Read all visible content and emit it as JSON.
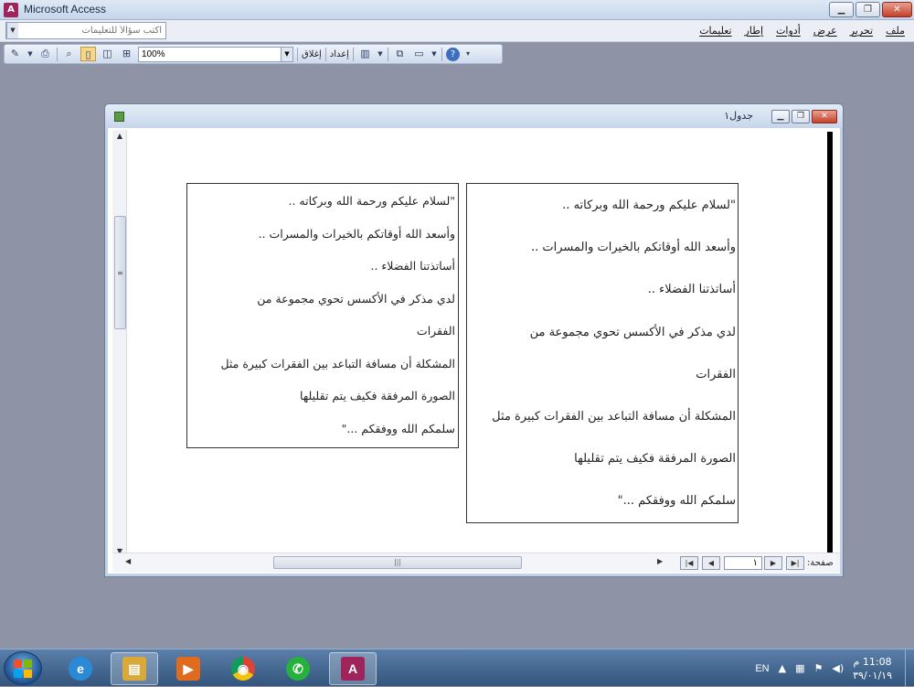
{
  "app": {
    "title": "Microsoft Access",
    "icon_letter": "A"
  },
  "window_controls": {
    "minimize": "▁",
    "restore": "❐",
    "close": "✕"
  },
  "help_box": {
    "placeholder": "اكتب سؤالاً للتعليمات"
  },
  "menus": [
    "ملف",
    "تحرير",
    "عرض",
    "أدوات",
    "إطار",
    "تعليمات"
  ],
  "toolbar": {
    "zoom_value": "100%",
    "close_label": "إغلاق",
    "setup_label": "إعداد"
  },
  "document": {
    "title": "جدول١",
    "paragraph_lines": [
      "\"لسلام عليكم ورحمة الله وبركاته ..",
      "وأسعد الله أوقاتكم بالخيرات والمسرات ..",
      "أساتذتنا الفضلاء ..",
      "لدي مذكر في الأكسس تحوي مجموعة من",
      "الفقرات",
      "المشكلة أن مسافة التباعد بين الفقرات كبيرة مثل",
      "الصورة المرفقة فكيف يتم تقليلها",
      "سلمكم الله ووفقكم ...\""
    ]
  },
  "navigation": {
    "page_label": "صفحة:",
    "current_page": "١"
  },
  "taskbar": {
    "apps": [
      {
        "name": "internet-explorer",
        "glyph": "e",
        "color": "#2a8ad8"
      },
      {
        "name": "file-explorer",
        "glyph": "▤",
        "color": "#d9a93a"
      },
      {
        "name": "media-player",
        "glyph": "▶",
        "color": "#e06b1f"
      },
      {
        "name": "chrome",
        "glyph": "◉",
        "color": "#3b9a3b"
      },
      {
        "name": "whatsapp",
        "glyph": "✆",
        "color": "#25b13b"
      },
      {
        "name": "access",
        "glyph": "A",
        "color": "#a0245c"
      }
    ],
    "language": "EN",
    "time": "11:08 م",
    "date": "٣٩/٠١/١٩"
  }
}
